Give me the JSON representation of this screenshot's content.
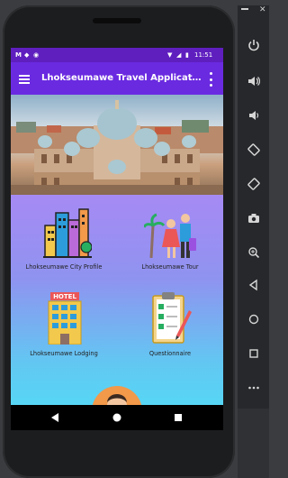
{
  "status_bar": {
    "time": "11:51"
  },
  "app_bar": {
    "title": "Lhokseumawe Travel Applicati..."
  },
  "menu": [
    {
      "label": "Lhokseumawe City Profile",
      "icon": "city-buildings-icon"
    },
    {
      "label": "Lhokseumawe Tour",
      "icon": "tourists-icon"
    },
    {
      "label": "Lhokseumawe Lodging",
      "icon": "hotel-building-icon",
      "sign": "HOTEL"
    },
    {
      "label": "Questionnaire",
      "icon": "checklist-icon"
    }
  ],
  "side_panel": {
    "tools": [
      "power-icon",
      "volume-up-icon",
      "volume-down-icon",
      "rotate-left-icon",
      "rotate-right-icon",
      "camera-icon",
      "zoom-icon",
      "back-icon",
      "home-icon",
      "overview-icon",
      "more-icon"
    ]
  },
  "colors": {
    "app_bar": "#6a2ae0",
    "status_bar": "#5f1fbf",
    "gradient_top": "#a68af4",
    "gradient_bottom": "#57d6f5"
  }
}
